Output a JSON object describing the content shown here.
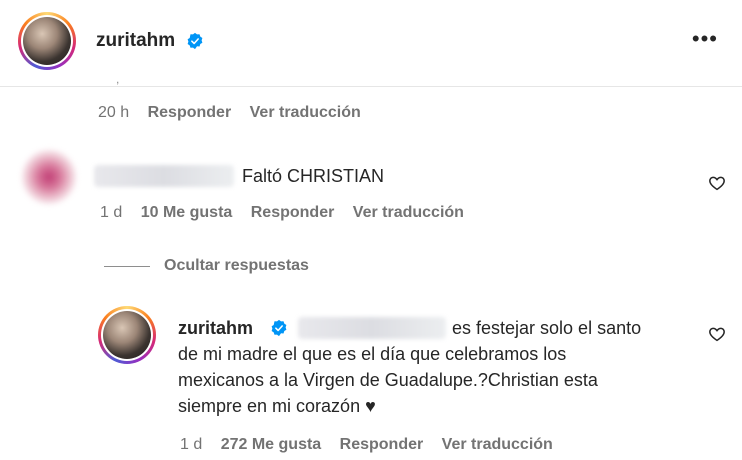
{
  "header": {
    "username": "zuritahm",
    "more_icon": "more-horizontal-icon"
  },
  "first_comment_meta": {
    "time": "20 h",
    "reply": "Responder",
    "translate": "Ver traducción"
  },
  "comment": {
    "text": "Faltó CHRISTIAN",
    "time": "1 d",
    "likes": "10 Me gusta",
    "reply": "Responder",
    "translate": "Ver traducción"
  },
  "hide_replies": "Ocultar respuestas",
  "reply": {
    "username": "zuritahm",
    "text_line1": "es festejar solo el santo",
    "text_line2": "de mi madre el que es el día que celebramos los",
    "text_line3": "mexicanos a la Virgen de Guadalupe.?Christian esta",
    "text_line4": "siempre en mi corazón ♥",
    "time": "1 d",
    "likes": "272 Me gusta",
    "reply": "Responder",
    "translate": "Ver traducción"
  },
  "colors": {
    "verified": "#0095f6",
    "secondary_text": "#737373",
    "primary_text": "#262626"
  }
}
